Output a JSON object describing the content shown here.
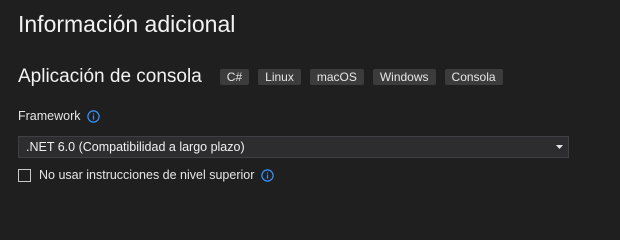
{
  "page": {
    "title": "Información adicional"
  },
  "template": {
    "name": "Aplicación de consola",
    "tags": [
      "C#",
      "Linux",
      "macOS",
      "Windows",
      "Consola"
    ]
  },
  "framework": {
    "label": "Framework",
    "label_icon": "info-icon",
    "selected_value": ".NET 6.0 (Compatibilidad a largo plazo)",
    "dropdown_icon": "chevron-down-icon"
  },
  "options": {
    "top_level_statements_label": "No usar instrucciones de nivel superior",
    "top_level_statements_checked": false,
    "info_icon": "info-icon"
  },
  "colors": {
    "background": "#1f1f1f",
    "tag_background": "#3c3c3c",
    "select_background": "#2d2d30",
    "info_icon": "#3794ff",
    "text": "#e6e6e6"
  }
}
